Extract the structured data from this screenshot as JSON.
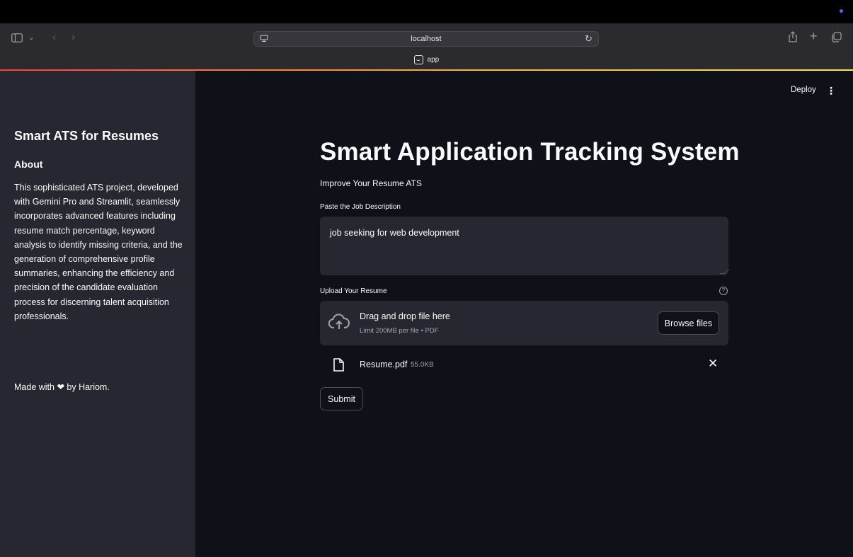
{
  "browser": {
    "url": "localhost",
    "tab_title": "app"
  },
  "header": {
    "deploy_label": "Deploy",
    "menu_icon": "⋮"
  },
  "sidebar": {
    "title": "Smart ATS for Resumes",
    "about_heading": "About",
    "about_text": "This sophisticated ATS project, developed with Gemini Pro and Streamlit, seamlessly incorporates advanced features including resume match percentage, keyword analysis to identify missing criteria, and the generation of comprehensive profile summaries, enhancing the efficiency and precision of the candidate evaluation process for discerning talent acquisition professionals.",
    "made_with": "Made with ❤ by Hariom."
  },
  "main": {
    "title": "Smart Application Tracking System",
    "subtitle": "Improve Your Resume ATS",
    "jd_label": "Paste the Job Description",
    "jd_value": "job seeking for web development",
    "upload_label": "Upload Your Resume",
    "help_icon": "?",
    "dropzone_text": "Drag and drop file here",
    "dropzone_limit": "Limit 200MB per file • PDF",
    "browse_label": "Browse files",
    "file_name": "Resume.pdf",
    "file_size": "55.0KB",
    "remove_icon": "✕",
    "submit_label": "Submit"
  },
  "colors": {
    "sidebar_bg": "#262730",
    "main_bg": "#0e1117",
    "input_bg": "#262730",
    "text": "#fafafa",
    "accent_gradient": [
      "#ff3d3d",
      "#ffbe2e",
      "#ffe14d"
    ]
  }
}
